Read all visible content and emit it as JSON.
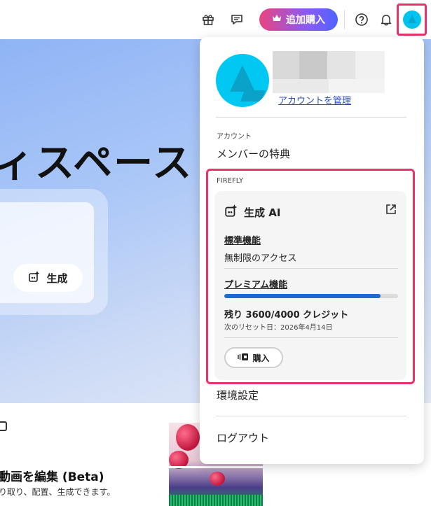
{
  "header": {
    "buy_label": "追加購入"
  },
  "hero": {
    "title": "ィスペース",
    "generate_label": "生成"
  },
  "lower": {
    "card_title": "動画を編集 (Beta)",
    "card_desc": "り取り、配置、生成できます。"
  },
  "account_menu": {
    "manage_account": "アカウントを管理",
    "account_section": "アカウント",
    "member_benefits": "メンバーの特典",
    "firefly_section": "FIREFLY",
    "firefly_card": {
      "title": "生成 AI",
      "standard_label": "標準機能",
      "standard_value": "無制限のアクセス",
      "premium_label": "プレミアム機能",
      "premium_used_fraction": 0.9,
      "credits_text": "残り 3600/4000 クレジット",
      "reset_text": "次のリセット日：2026年4月14日",
      "buy_label": "購入"
    },
    "preferences": "環境設定",
    "logout": "ログアウト"
  },
  "colors": {
    "accent_highlight": "#e8336b",
    "progress_blue": "#1e69d6",
    "link_blue": "#2b4fb6",
    "avatar_cyan": "#00c8f2"
  },
  "icons": [
    "gift-icon",
    "chat-icon",
    "crown-icon",
    "help-icon",
    "bell-icon",
    "sparkle-icon",
    "external-link-icon",
    "credit-card-icon"
  ]
}
